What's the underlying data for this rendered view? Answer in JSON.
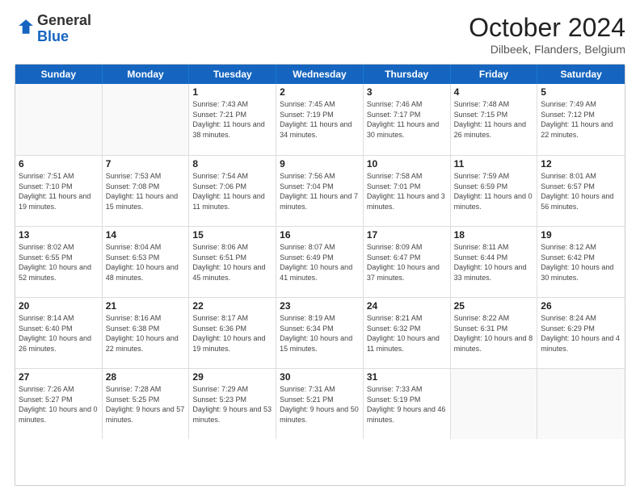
{
  "logo": {
    "line1": "General",
    "line2": "Blue"
  },
  "title": "October 2024",
  "subtitle": "Dilbeek, Flanders, Belgium",
  "header_days": [
    "Sunday",
    "Monday",
    "Tuesday",
    "Wednesday",
    "Thursday",
    "Friday",
    "Saturday"
  ],
  "weeks": [
    [
      {
        "day": "",
        "sunrise": "",
        "sunset": "",
        "daylight": ""
      },
      {
        "day": "",
        "sunrise": "",
        "sunset": "",
        "daylight": ""
      },
      {
        "day": "1",
        "sunrise": "Sunrise: 7:43 AM",
        "sunset": "Sunset: 7:21 PM",
        "daylight": "Daylight: 11 hours and 38 minutes."
      },
      {
        "day": "2",
        "sunrise": "Sunrise: 7:45 AM",
        "sunset": "Sunset: 7:19 PM",
        "daylight": "Daylight: 11 hours and 34 minutes."
      },
      {
        "day": "3",
        "sunrise": "Sunrise: 7:46 AM",
        "sunset": "Sunset: 7:17 PM",
        "daylight": "Daylight: 11 hours and 30 minutes."
      },
      {
        "day": "4",
        "sunrise": "Sunrise: 7:48 AM",
        "sunset": "Sunset: 7:15 PM",
        "daylight": "Daylight: 11 hours and 26 minutes."
      },
      {
        "day": "5",
        "sunrise": "Sunrise: 7:49 AM",
        "sunset": "Sunset: 7:12 PM",
        "daylight": "Daylight: 11 hours and 22 minutes."
      }
    ],
    [
      {
        "day": "6",
        "sunrise": "Sunrise: 7:51 AM",
        "sunset": "Sunset: 7:10 PM",
        "daylight": "Daylight: 11 hours and 19 minutes."
      },
      {
        "day": "7",
        "sunrise": "Sunrise: 7:53 AM",
        "sunset": "Sunset: 7:08 PM",
        "daylight": "Daylight: 11 hours and 15 minutes."
      },
      {
        "day": "8",
        "sunrise": "Sunrise: 7:54 AM",
        "sunset": "Sunset: 7:06 PM",
        "daylight": "Daylight: 11 hours and 11 minutes."
      },
      {
        "day": "9",
        "sunrise": "Sunrise: 7:56 AM",
        "sunset": "Sunset: 7:04 PM",
        "daylight": "Daylight: 11 hours and 7 minutes."
      },
      {
        "day": "10",
        "sunrise": "Sunrise: 7:58 AM",
        "sunset": "Sunset: 7:01 PM",
        "daylight": "Daylight: 11 hours and 3 minutes."
      },
      {
        "day": "11",
        "sunrise": "Sunrise: 7:59 AM",
        "sunset": "Sunset: 6:59 PM",
        "daylight": "Daylight: 11 hours and 0 minutes."
      },
      {
        "day": "12",
        "sunrise": "Sunrise: 8:01 AM",
        "sunset": "Sunset: 6:57 PM",
        "daylight": "Daylight: 10 hours and 56 minutes."
      }
    ],
    [
      {
        "day": "13",
        "sunrise": "Sunrise: 8:02 AM",
        "sunset": "Sunset: 6:55 PM",
        "daylight": "Daylight: 10 hours and 52 minutes."
      },
      {
        "day": "14",
        "sunrise": "Sunrise: 8:04 AM",
        "sunset": "Sunset: 6:53 PM",
        "daylight": "Daylight: 10 hours and 48 minutes."
      },
      {
        "day": "15",
        "sunrise": "Sunrise: 8:06 AM",
        "sunset": "Sunset: 6:51 PM",
        "daylight": "Daylight: 10 hours and 45 minutes."
      },
      {
        "day": "16",
        "sunrise": "Sunrise: 8:07 AM",
        "sunset": "Sunset: 6:49 PM",
        "daylight": "Daylight: 10 hours and 41 minutes."
      },
      {
        "day": "17",
        "sunrise": "Sunrise: 8:09 AM",
        "sunset": "Sunset: 6:47 PM",
        "daylight": "Daylight: 10 hours and 37 minutes."
      },
      {
        "day": "18",
        "sunrise": "Sunrise: 8:11 AM",
        "sunset": "Sunset: 6:44 PM",
        "daylight": "Daylight: 10 hours and 33 minutes."
      },
      {
        "day": "19",
        "sunrise": "Sunrise: 8:12 AM",
        "sunset": "Sunset: 6:42 PM",
        "daylight": "Daylight: 10 hours and 30 minutes."
      }
    ],
    [
      {
        "day": "20",
        "sunrise": "Sunrise: 8:14 AM",
        "sunset": "Sunset: 6:40 PM",
        "daylight": "Daylight: 10 hours and 26 minutes."
      },
      {
        "day": "21",
        "sunrise": "Sunrise: 8:16 AM",
        "sunset": "Sunset: 6:38 PM",
        "daylight": "Daylight: 10 hours and 22 minutes."
      },
      {
        "day": "22",
        "sunrise": "Sunrise: 8:17 AM",
        "sunset": "Sunset: 6:36 PM",
        "daylight": "Daylight: 10 hours and 19 minutes."
      },
      {
        "day": "23",
        "sunrise": "Sunrise: 8:19 AM",
        "sunset": "Sunset: 6:34 PM",
        "daylight": "Daylight: 10 hours and 15 minutes."
      },
      {
        "day": "24",
        "sunrise": "Sunrise: 8:21 AM",
        "sunset": "Sunset: 6:32 PM",
        "daylight": "Daylight: 10 hours and 11 minutes."
      },
      {
        "day": "25",
        "sunrise": "Sunrise: 8:22 AM",
        "sunset": "Sunset: 6:31 PM",
        "daylight": "Daylight: 10 hours and 8 minutes."
      },
      {
        "day": "26",
        "sunrise": "Sunrise: 8:24 AM",
        "sunset": "Sunset: 6:29 PM",
        "daylight": "Daylight: 10 hours and 4 minutes."
      }
    ],
    [
      {
        "day": "27",
        "sunrise": "Sunrise: 7:26 AM",
        "sunset": "Sunset: 5:27 PM",
        "daylight": "Daylight: 10 hours and 0 minutes."
      },
      {
        "day": "28",
        "sunrise": "Sunrise: 7:28 AM",
        "sunset": "Sunset: 5:25 PM",
        "daylight": "Daylight: 9 hours and 57 minutes."
      },
      {
        "day": "29",
        "sunrise": "Sunrise: 7:29 AM",
        "sunset": "Sunset: 5:23 PM",
        "daylight": "Daylight: 9 hours and 53 minutes."
      },
      {
        "day": "30",
        "sunrise": "Sunrise: 7:31 AM",
        "sunset": "Sunset: 5:21 PM",
        "daylight": "Daylight: 9 hours and 50 minutes."
      },
      {
        "day": "31",
        "sunrise": "Sunrise: 7:33 AM",
        "sunset": "Sunset: 5:19 PM",
        "daylight": "Daylight: 9 hours and 46 minutes."
      },
      {
        "day": "",
        "sunrise": "",
        "sunset": "",
        "daylight": ""
      },
      {
        "day": "",
        "sunrise": "",
        "sunset": "",
        "daylight": ""
      }
    ]
  ]
}
